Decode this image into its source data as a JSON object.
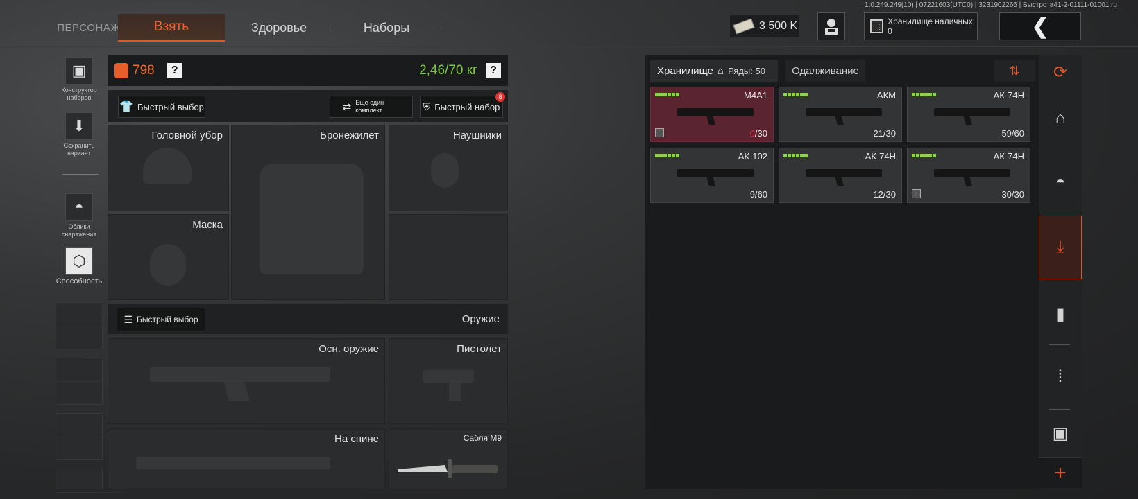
{
  "version": "1.0.249.249(10) | 07221603(UTC0) | 3231902266 | Быстрота41-2-01111-01001.ru",
  "nav": {
    "persona": "ПЕРСОНАЖ",
    "take": "Взять",
    "health": "Здоровье",
    "kits": "Наборы"
  },
  "header": {
    "money": "3 500 K",
    "cash_storage": "Хранилище наличных: 0"
  },
  "left_tools": {
    "kit_constructor": "Конструктор наборов",
    "save_variant": "Сохранить вариант",
    "gear_skins": "Облики снаряжения",
    "ability": "Способность"
  },
  "loadout": {
    "armor_value": "798",
    "weight": "2,46/70 кг",
    "help": "?",
    "quick_pick": "Быстрый выбор",
    "another_set": "Еще один комплект",
    "quick_kit": "Быстрый набор",
    "quick_kit_badge": "8",
    "slots": {
      "helmet": "Головной убор",
      "vest": "Бронежилет",
      "headphones": "Наушники",
      "mask": "Маска",
      "weapons_header": "Оружие",
      "weapons_quick": "Быстрый выбор",
      "primary": "Осн. оружие",
      "pistol": "Пистолет",
      "back": "На спине",
      "melee": "Сабля M9"
    }
  },
  "storage": {
    "tab_storage": "Хранилище",
    "rows": "Ряды: 50",
    "tab_lend": "Одалживание",
    "weapons": [
      {
        "name": "M4A1",
        "ammo_cur": "0",
        "ammo_max": "/30",
        "selected": true
      },
      {
        "name": "АКМ",
        "ammo_cur": "21",
        "ammo_max": "/30",
        "selected": false
      },
      {
        "name": "АК-74Н",
        "ammo_cur": "59",
        "ammo_max": "/60",
        "selected": false
      },
      {
        "name": "АК-102",
        "ammo_cur": "9",
        "ammo_max": "/60",
        "selected": false
      },
      {
        "name": "АК-74Н",
        "ammo_cur": "12",
        "ammo_max": "/30",
        "selected": false
      },
      {
        "name": "АК-74Н",
        "ammo_cur": "30",
        "ammo_max": "/30",
        "selected": false
      }
    ]
  },
  "sidebar_icons": [
    "stack-refresh-icon",
    "home-icon",
    "helmet-icon",
    "weapon-drop-icon",
    "magazine-icon",
    "ammo-icon",
    "armor-icon",
    "plus-icon"
  ],
  "colors": {
    "accent": "#e0562a",
    "weight_ok": "#7ec843",
    "selected_card": "#5a2430",
    "ammo_empty": "#e0304a"
  }
}
